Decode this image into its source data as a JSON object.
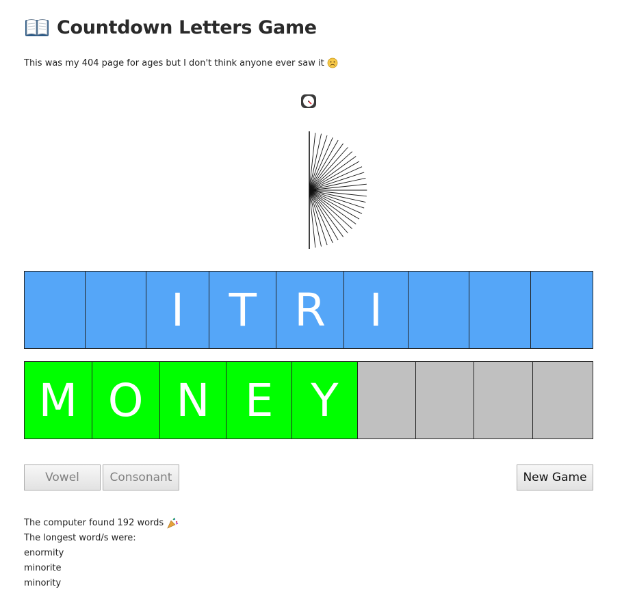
{
  "header": {
    "title": "Countdown Letters Game",
    "book_icon": "open-book-icon"
  },
  "subtitle": {
    "text": "This was my 404 page for ages but I don't think anyone ever saw it",
    "emoji_icon": "sad-face-icon"
  },
  "timer": {
    "icon": "stopwatch-icon",
    "progress": 0.5
  },
  "letters": [
    "",
    "",
    "I",
    "T",
    "R",
    "I",
    "",
    "",
    ""
  ],
  "guess": [
    "M",
    "O",
    "N",
    "E",
    "Y",
    "",
    "",
    "",
    ""
  ],
  "buttons": {
    "vowel": "Vowel",
    "consonant": "Consonant",
    "new_game": "New Game"
  },
  "results": {
    "found_text": "The computer found 192 words",
    "found_icon": "party-popper-icon",
    "longest_label": "The longest word/s were:",
    "words": [
      "enormity",
      "minorite",
      "minority"
    ]
  },
  "colors": {
    "letter_tile": "#55a6f8",
    "guess_tile": "#00ff00",
    "empty_tile": "#c0c0c0"
  }
}
